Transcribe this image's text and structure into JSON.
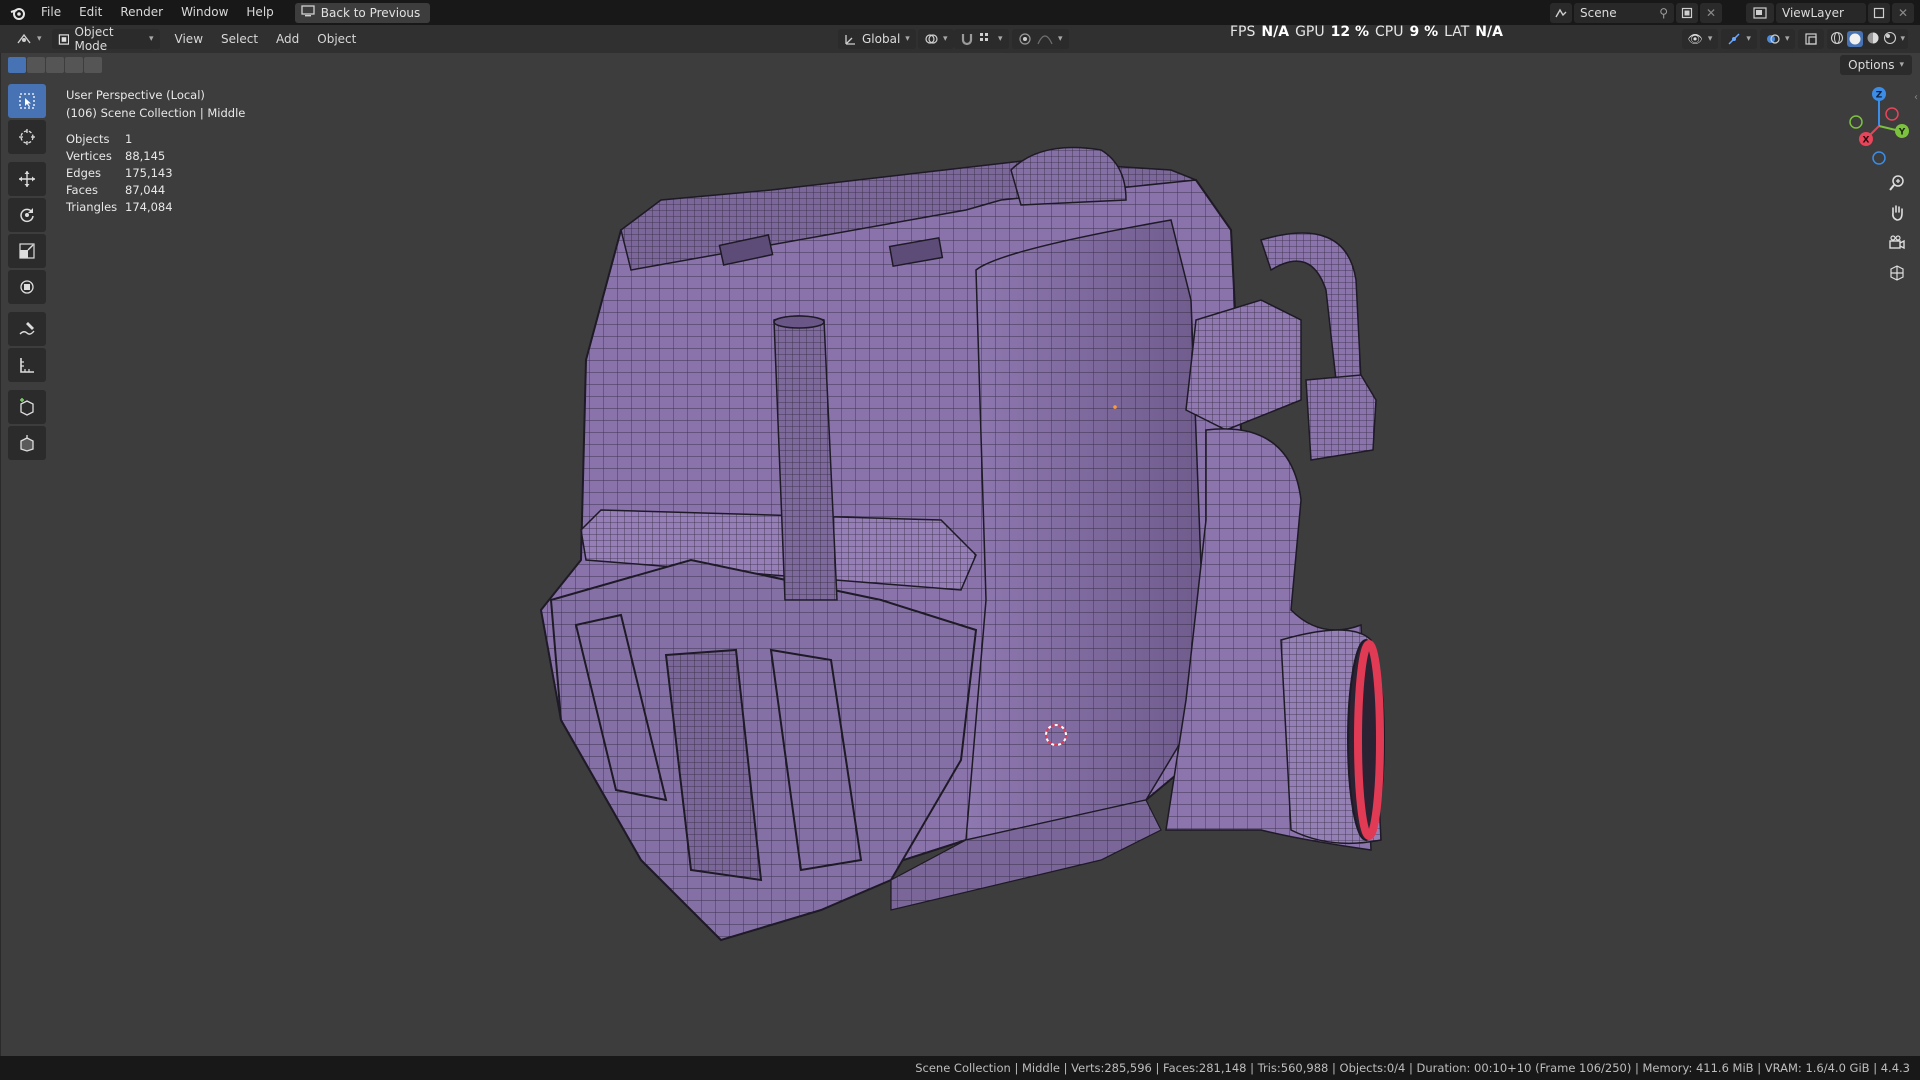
{
  "menubar": {
    "items": [
      "File",
      "Edit",
      "Render",
      "Window",
      "Help"
    ],
    "back_button": "Back to Previous",
    "scene_name": "Scene",
    "view_layer": "ViewLayer"
  },
  "header": {
    "mode": "Object Mode",
    "menus": [
      "View",
      "Select",
      "Add",
      "Object"
    ],
    "transform_orientation": "Global",
    "options_label": "Options"
  },
  "perf_hud": {
    "fps_label": "FPS",
    "fps_value": "N/A",
    "gpu_label": "GPU",
    "gpu_value": "12 %",
    "cpu_label": "CPU",
    "cpu_value": "9 %",
    "lat_label": "LAT",
    "lat_value": "N/A"
  },
  "viewport": {
    "perspective": "User Perspective (Local)",
    "collection": "(106) Scene Collection | Middle",
    "stats": [
      {
        "label": "Objects",
        "value": "1"
      },
      {
        "label": "Vertices",
        "value": "88,145"
      },
      {
        "label": "Edges",
        "value": "175,143"
      },
      {
        "label": "Faces",
        "value": "87,044"
      },
      {
        "label": "Triangles",
        "value": "174,084"
      }
    ],
    "gizmo": {
      "z": "Z",
      "y": "Y",
      "x": "X"
    },
    "mesh_color": "#8b73ad",
    "wire_color": "#1e1a26",
    "rim_color": "#e03a55"
  },
  "toolbar": {
    "tools": [
      "select-box-icon",
      "cursor-icon",
      "move-icon",
      "rotate-icon",
      "scale-icon",
      "transform-icon",
      "annotate-icon",
      "measure-icon",
      "add-cube-icon",
      "extrude-cube-icon"
    ]
  },
  "statusbar": {
    "text": "Scene Collection | Middle | Verts:285,596 | Faces:281,148 | Tris:560,988 | Objects:0/4 | Duration: 00:10+10 (Frame 106/250) | Memory: 411.6 MiB | VRAM: 1.6/4.0 GiB | 4.4.3"
  },
  "colors": {
    "accent": "#4772b3",
    "viewport_bg": "#3d3d3d",
    "axis_x": "#e8445a",
    "axis_y": "#7cc23f",
    "axis_z": "#3b8de8"
  }
}
